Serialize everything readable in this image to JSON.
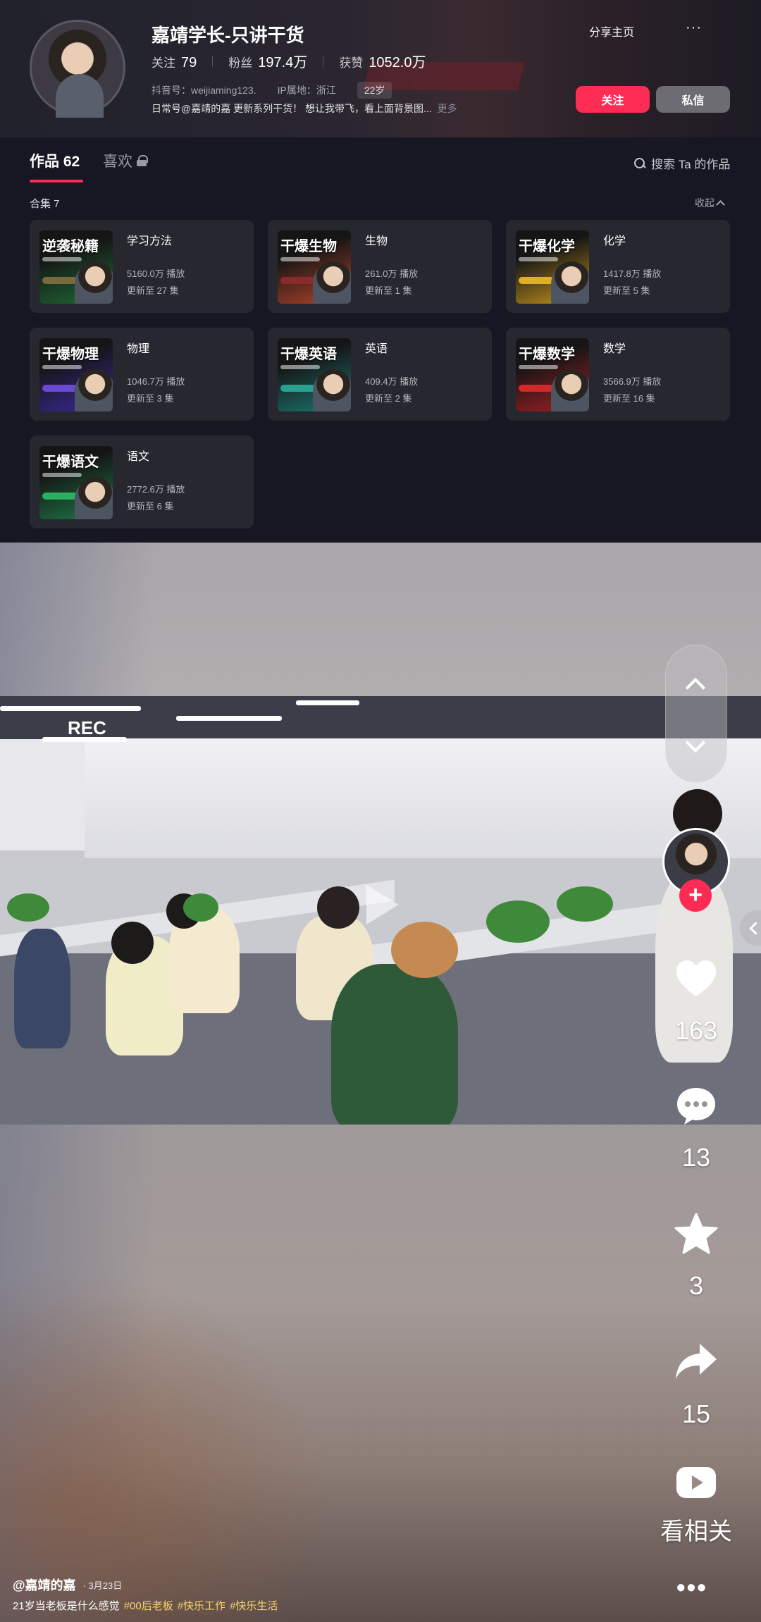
{
  "profile": {
    "name": "嘉靖学长-只讲干货",
    "following_label": "关注",
    "following": "79",
    "fans_label": "粉丝",
    "fans": "197.4万",
    "likes_label": "获赞",
    "likes": "1052.0万",
    "douyin_id": "抖音号：weijiaming123.",
    "ip": "IP属地：浙江",
    "age": "22岁",
    "bio": "日常号@嘉靖的嘉 更新系列干货！ 想让我带飞，看上面背景图...",
    "bio_more": "更多",
    "share_label": "分享主页",
    "menu_label": "···",
    "follow_btn": "关注",
    "message_btn": "私信"
  },
  "tabs": {
    "works": "作品 62",
    "likes": "喜欢",
    "search": "搜索 Ta 的作品"
  },
  "collections": {
    "header": "合集 7",
    "collapse": "收起",
    "items": [
      {
        "title": "学习方法",
        "plays": "5160.0万 播放",
        "updates": "更新至 27 集",
        "thumb": "逆袭秘籍",
        "color": "#1f6b35"
      },
      {
        "title": "生物",
        "plays": "261.0万 播放",
        "updates": "更新至 1 集",
        "thumb": "干爆生物",
        "color": "#b5452b"
      },
      {
        "title": "化学",
        "plays": "1417.8万 播放",
        "updates": "更新至 5 集",
        "thumb": "干爆化学",
        "color": "#c7961c"
      },
      {
        "title": "物理",
        "plays": "1046.7万 播放",
        "updates": "更新至 3 集",
        "thumb": "干爆物理",
        "color": "#3a2a9c"
      },
      {
        "title": "英语",
        "plays": "409.4万 播放",
        "updates": "更新至 2 集",
        "thumb": "干爆英语",
        "color": "#1b7a74"
      },
      {
        "title": "数学",
        "plays": "3566.9万 播放",
        "updates": "更新至 16 集",
        "thumb": "干爆数学",
        "color": "#a41f25"
      },
      {
        "title": "语文",
        "plays": "2772.6万 播放",
        "updates": "更新至 6 集",
        "thumb": "干爆语文",
        "color": "#1f7a47"
      }
    ]
  },
  "video": {
    "rec_label": "REC",
    "likes": "163",
    "comments": "13",
    "favorites": "3",
    "shares": "15",
    "related_label": "看相关",
    "more_label": "•••",
    "author": "@嘉靖的嘉",
    "date": "· 3月23日",
    "caption": "21岁当老板是什么感觉",
    "tags": [
      "#00后老板",
      "#快乐工作",
      "#快乐生活"
    ]
  },
  "colors": {
    "accent": "#fe2c55",
    "bg": "#161722",
    "card": "#26272f",
    "tag": "#f7d46b"
  }
}
